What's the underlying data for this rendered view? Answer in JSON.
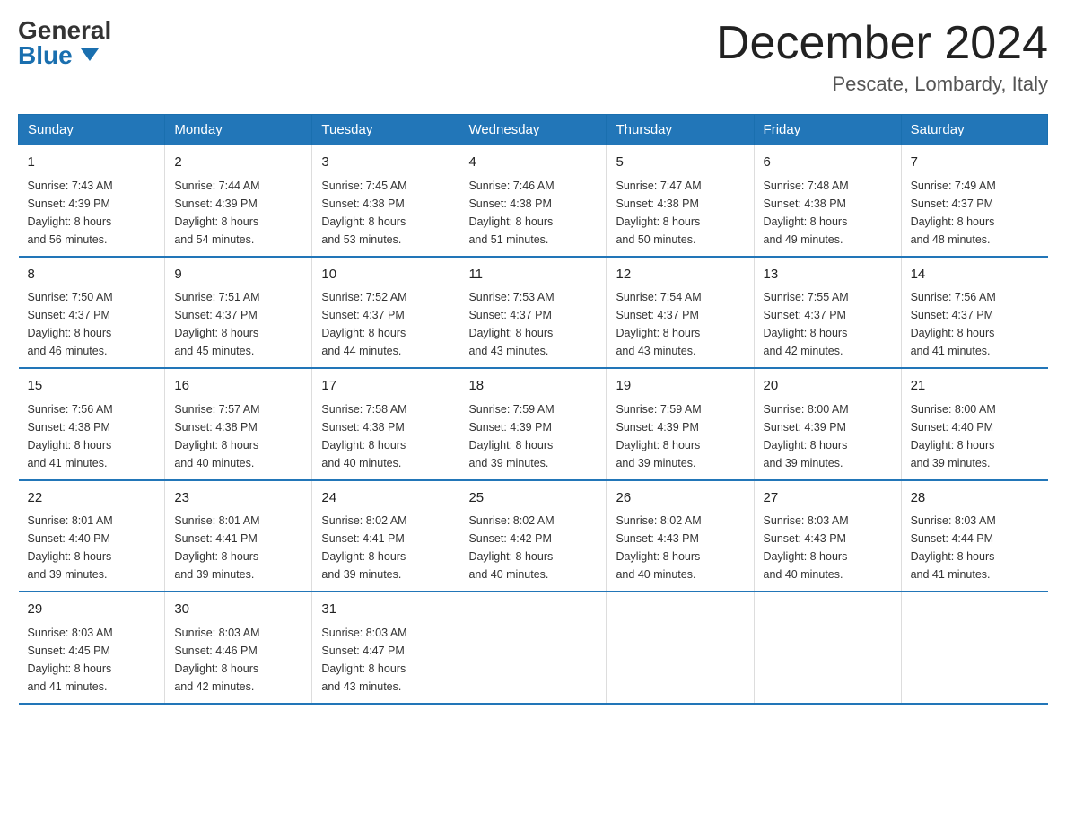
{
  "header": {
    "logo_general": "General",
    "logo_blue": "Blue",
    "month_title": "December 2024",
    "location": "Pescate, Lombardy, Italy"
  },
  "days_of_week": [
    "Sunday",
    "Monday",
    "Tuesday",
    "Wednesday",
    "Thursday",
    "Friday",
    "Saturday"
  ],
  "weeks": [
    [
      {
        "day": "1",
        "sunrise": "7:43 AM",
        "sunset": "4:39 PM",
        "daylight": "8 hours and 56 minutes."
      },
      {
        "day": "2",
        "sunrise": "7:44 AM",
        "sunset": "4:39 PM",
        "daylight": "8 hours and 54 minutes."
      },
      {
        "day": "3",
        "sunrise": "7:45 AM",
        "sunset": "4:38 PM",
        "daylight": "8 hours and 53 minutes."
      },
      {
        "day": "4",
        "sunrise": "7:46 AM",
        "sunset": "4:38 PM",
        "daylight": "8 hours and 51 minutes."
      },
      {
        "day": "5",
        "sunrise": "7:47 AM",
        "sunset": "4:38 PM",
        "daylight": "8 hours and 50 minutes."
      },
      {
        "day": "6",
        "sunrise": "7:48 AM",
        "sunset": "4:38 PM",
        "daylight": "8 hours and 49 minutes."
      },
      {
        "day": "7",
        "sunrise": "7:49 AM",
        "sunset": "4:37 PM",
        "daylight": "8 hours and 48 minutes."
      }
    ],
    [
      {
        "day": "8",
        "sunrise": "7:50 AM",
        "sunset": "4:37 PM",
        "daylight": "8 hours and 46 minutes."
      },
      {
        "day": "9",
        "sunrise": "7:51 AM",
        "sunset": "4:37 PM",
        "daylight": "8 hours and 45 minutes."
      },
      {
        "day": "10",
        "sunrise": "7:52 AM",
        "sunset": "4:37 PM",
        "daylight": "8 hours and 44 minutes."
      },
      {
        "day": "11",
        "sunrise": "7:53 AM",
        "sunset": "4:37 PM",
        "daylight": "8 hours and 43 minutes."
      },
      {
        "day": "12",
        "sunrise": "7:54 AM",
        "sunset": "4:37 PM",
        "daylight": "8 hours and 43 minutes."
      },
      {
        "day": "13",
        "sunrise": "7:55 AM",
        "sunset": "4:37 PM",
        "daylight": "8 hours and 42 minutes."
      },
      {
        "day": "14",
        "sunrise": "7:56 AM",
        "sunset": "4:37 PM",
        "daylight": "8 hours and 41 minutes."
      }
    ],
    [
      {
        "day": "15",
        "sunrise": "7:56 AM",
        "sunset": "4:38 PM",
        "daylight": "8 hours and 41 minutes."
      },
      {
        "day": "16",
        "sunrise": "7:57 AM",
        "sunset": "4:38 PM",
        "daylight": "8 hours and 40 minutes."
      },
      {
        "day": "17",
        "sunrise": "7:58 AM",
        "sunset": "4:38 PM",
        "daylight": "8 hours and 40 minutes."
      },
      {
        "day": "18",
        "sunrise": "7:59 AM",
        "sunset": "4:39 PM",
        "daylight": "8 hours and 39 minutes."
      },
      {
        "day": "19",
        "sunrise": "7:59 AM",
        "sunset": "4:39 PM",
        "daylight": "8 hours and 39 minutes."
      },
      {
        "day": "20",
        "sunrise": "8:00 AM",
        "sunset": "4:39 PM",
        "daylight": "8 hours and 39 minutes."
      },
      {
        "day": "21",
        "sunrise": "8:00 AM",
        "sunset": "4:40 PM",
        "daylight": "8 hours and 39 minutes."
      }
    ],
    [
      {
        "day": "22",
        "sunrise": "8:01 AM",
        "sunset": "4:40 PM",
        "daylight": "8 hours and 39 minutes."
      },
      {
        "day": "23",
        "sunrise": "8:01 AM",
        "sunset": "4:41 PM",
        "daylight": "8 hours and 39 minutes."
      },
      {
        "day": "24",
        "sunrise": "8:02 AM",
        "sunset": "4:41 PM",
        "daylight": "8 hours and 39 minutes."
      },
      {
        "day": "25",
        "sunrise": "8:02 AM",
        "sunset": "4:42 PM",
        "daylight": "8 hours and 40 minutes."
      },
      {
        "day": "26",
        "sunrise": "8:02 AM",
        "sunset": "4:43 PM",
        "daylight": "8 hours and 40 minutes."
      },
      {
        "day": "27",
        "sunrise": "8:03 AM",
        "sunset": "4:43 PM",
        "daylight": "8 hours and 40 minutes."
      },
      {
        "day": "28",
        "sunrise": "8:03 AM",
        "sunset": "4:44 PM",
        "daylight": "8 hours and 41 minutes."
      }
    ],
    [
      {
        "day": "29",
        "sunrise": "8:03 AM",
        "sunset": "4:45 PM",
        "daylight": "8 hours and 41 minutes."
      },
      {
        "day": "30",
        "sunrise": "8:03 AM",
        "sunset": "4:46 PM",
        "daylight": "8 hours and 42 minutes."
      },
      {
        "day": "31",
        "sunrise": "8:03 AM",
        "sunset": "4:47 PM",
        "daylight": "8 hours and 43 minutes."
      },
      null,
      null,
      null,
      null
    ]
  ],
  "labels": {
    "sunrise": "Sunrise:",
    "sunset": "Sunset:",
    "daylight": "Daylight:"
  }
}
